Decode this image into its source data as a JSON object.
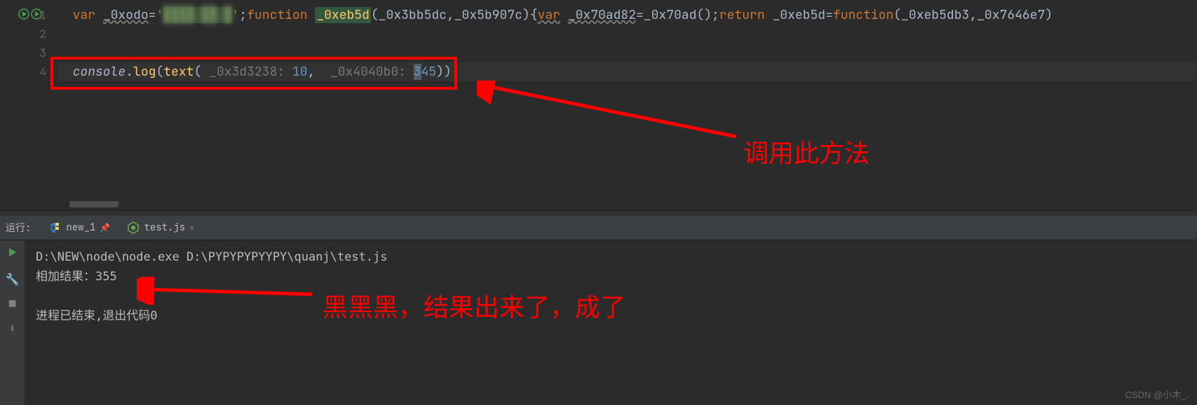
{
  "gutter": {
    "lines": [
      "1",
      "2",
      "3",
      "4"
    ]
  },
  "code": {
    "line1": {
      "kw1": "var",
      "v1": "_0xodo",
      "eq": "=",
      "str_open": "'",
      "str_blur": "████ ██ █",
      "str_close": "'",
      "semi": ";",
      "kw2": "function",
      "fn1": "_0xeb5d",
      "open": "(",
      "p1": "_0x3bb5dc",
      "c": ",",
      "p2": "_0x5b907c",
      "close": ")",
      "brace": "{",
      "kw3": "var",
      "v2": "_0x70ad82",
      "eq2": "=",
      "fn2": "_0x70ad",
      "call": "()",
      "semi2": ";",
      "kw4": "return",
      "sp": " ",
      "v3": "_0xeb5d",
      "eq3": "=",
      "kw5": "function",
      "open2": "(",
      "p3": "_0xeb5db3",
      "c2": ",",
      "p4": "_0x7646e7",
      "close2": ")"
    },
    "line4": {
      "obj": "console",
      "dot": ".",
      "m": "log",
      "open": "(",
      "fn": "text",
      "open2": "(",
      "h1": "_0x3d3238:",
      "sp1": " ",
      "n1": "10",
      "c": ",",
      "sp2": "  ",
      "h2": "_0x4040b0:",
      "sp3": " ",
      "n2": "3",
      "n2b": "45",
      "close": "))"
    }
  },
  "run_label": "运行:",
  "tabs": [
    {
      "icon": "python",
      "name": "new_1",
      "pinned": true,
      "active": false
    },
    {
      "icon": "js",
      "name": "test.js",
      "pinned": false,
      "active": true
    }
  ],
  "terminal": {
    "line1": "D:\\NEW\\node\\node.exe D:\\PYPYPYPYYPY\\quanj\\test.js",
    "line2": "相加结果：355",
    "line3": "进程已结束,退出代码0"
  },
  "annotations": {
    "a1": "调用此方法",
    "a2": "黑黑黑，结果出来了，成了"
  },
  "watermark": "CSDN @小木_."
}
